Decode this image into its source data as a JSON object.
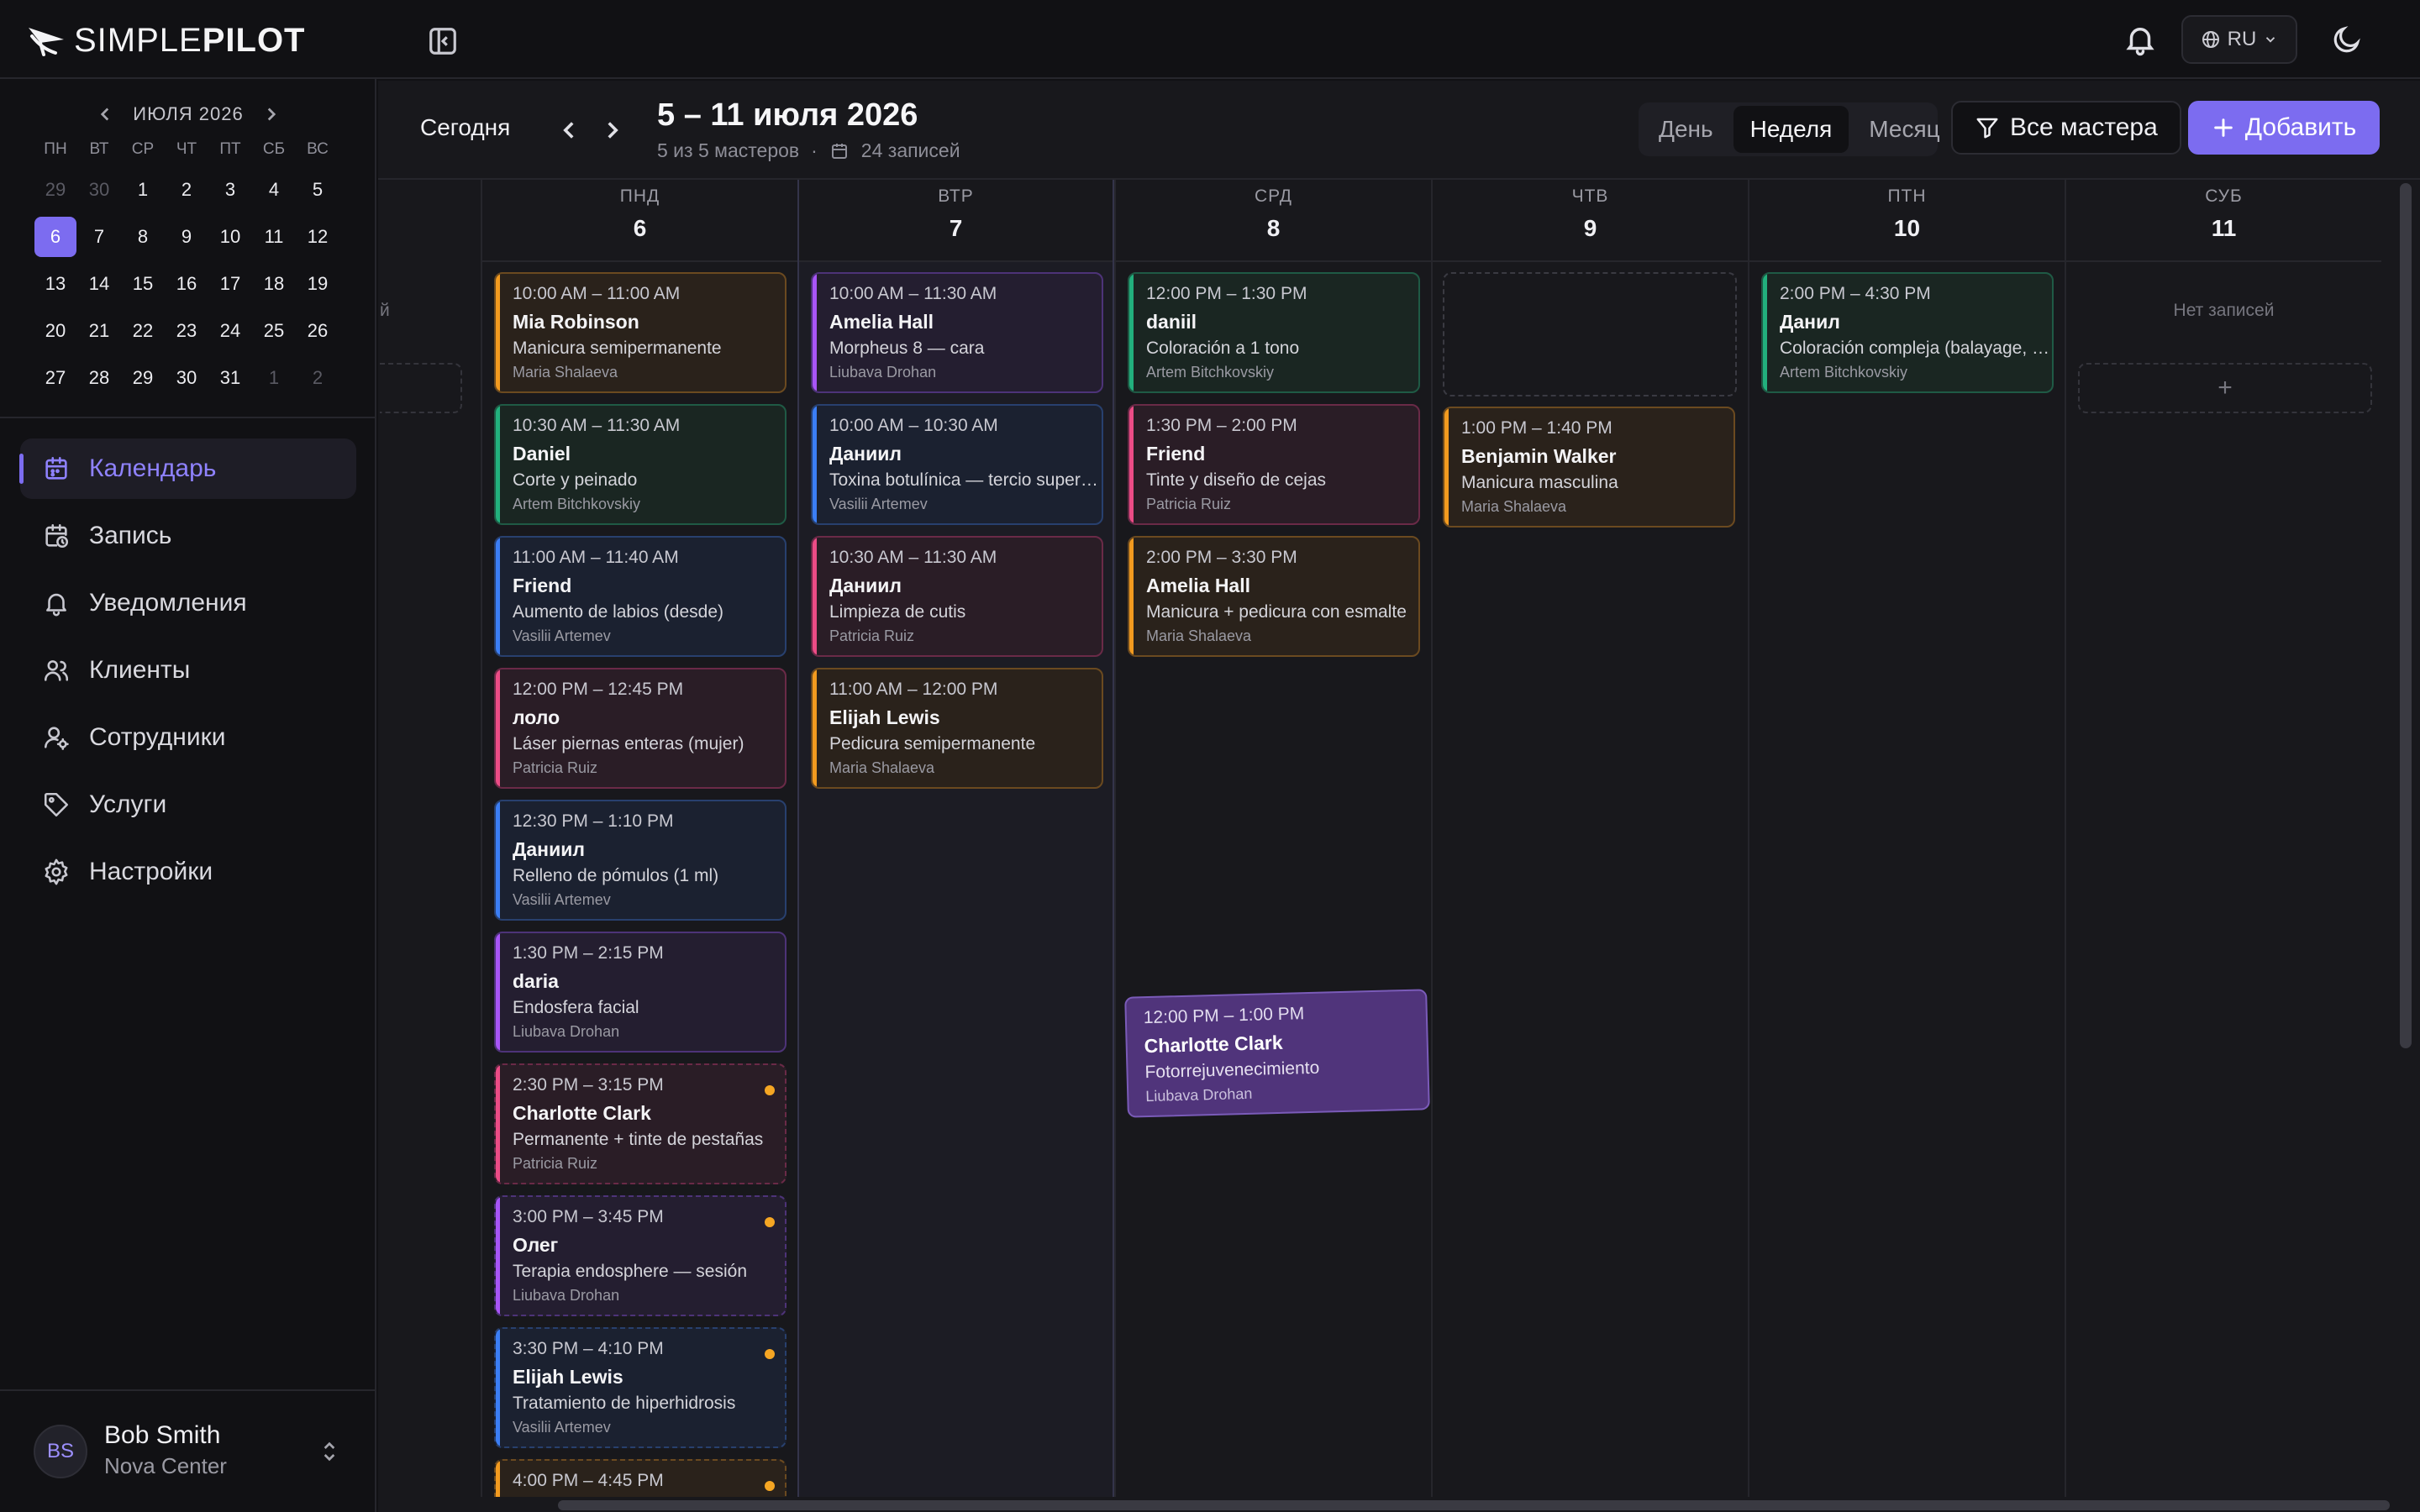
{
  "brand": {
    "logo_a": "SIMPLE",
    "logo_b": "PILOT"
  },
  "topbar": {
    "language": "RU"
  },
  "mini_calendar": {
    "month_label": "ИЮЛЯ 2026",
    "weekdays": [
      "ПН",
      "ВТ",
      "СР",
      "ЧТ",
      "ПТ",
      "СБ",
      "ВС"
    ],
    "days": [
      {
        "d": "29",
        "muted": true
      },
      {
        "d": "30",
        "muted": true
      },
      {
        "d": "1"
      },
      {
        "d": "2"
      },
      {
        "d": "3"
      },
      {
        "d": "4"
      },
      {
        "d": "5"
      },
      {
        "d": "6",
        "today": true
      },
      {
        "d": "7"
      },
      {
        "d": "8"
      },
      {
        "d": "9"
      },
      {
        "d": "10"
      },
      {
        "d": "11"
      },
      {
        "d": "12"
      },
      {
        "d": "13"
      },
      {
        "d": "14"
      },
      {
        "d": "15"
      },
      {
        "d": "16"
      },
      {
        "d": "17"
      },
      {
        "d": "18"
      },
      {
        "d": "19"
      },
      {
        "d": "20"
      },
      {
        "d": "21"
      },
      {
        "d": "22"
      },
      {
        "d": "23"
      },
      {
        "d": "24"
      },
      {
        "d": "25"
      },
      {
        "d": "26"
      },
      {
        "d": "27"
      },
      {
        "d": "28"
      },
      {
        "d": "29"
      },
      {
        "d": "30"
      },
      {
        "d": "31"
      },
      {
        "d": "1",
        "muted": true
      },
      {
        "d": "2",
        "muted": true
      }
    ]
  },
  "nav": [
    {
      "label": "Календарь",
      "icon": "calendar-icon",
      "active": true
    },
    {
      "label": "Запись",
      "icon": "calendar-clock-icon"
    },
    {
      "label": "Уведомления",
      "icon": "bell-icon"
    },
    {
      "label": "Клиенты",
      "icon": "users-icon"
    },
    {
      "label": "Сотрудники",
      "icon": "staff-icon"
    },
    {
      "label": "Услуги",
      "icon": "tag-icon"
    },
    {
      "label": "Настройки",
      "icon": "gear-icon"
    }
  ],
  "user": {
    "initials": "BS",
    "name": "Bob Smith",
    "org": "Nova Center"
  },
  "header": {
    "today": "Сегодня",
    "range": "5 – 11 июля 2026",
    "masters_count": "5 из 5 мастеров",
    "separator": "·",
    "records_count": "24 записей",
    "views": [
      {
        "label": "День"
      },
      {
        "label": "Неделя",
        "active": true
      },
      {
        "label": "Месяц"
      }
    ],
    "filter": "Все мастера",
    "add": "Добавить"
  },
  "colors": {
    "accent": "#7c6cf0",
    "orange": "#f29a1f",
    "green": "#22b07d",
    "blue": "#3b7ef5",
    "pink": "#ec4c86",
    "purple": "#a855f7",
    "pending_dot": "#f5a623"
  },
  "partial_column_text": "й",
  "days": [
    {
      "name": "ПНД",
      "num": "6",
      "appointments": [
        {
          "time": "10:00 AM – 11:00 AM",
          "client": "Mia Robinson",
          "service": "Manicura semipermanente",
          "staff": "Maria Shalaeva",
          "color": "orange"
        },
        {
          "time": "10:30 AM – 11:30 AM",
          "client": "Daniel",
          "service": "Corte y peinado",
          "staff": "Artem Bitchkovskiy",
          "color": "green"
        },
        {
          "time": "11:00 AM – 11:40 AM",
          "client": "Friend",
          "service": "Aumento de labios (desde)",
          "staff": "Vasilii Artemev",
          "color": "blue"
        },
        {
          "time": "12:00 PM – 12:45 PM",
          "client": "лоло",
          "service": "Láser piernas enteras (mujer)",
          "staff": "Patricia Ruiz",
          "color": "pink"
        },
        {
          "time": "12:30 PM – 1:10 PM",
          "client": "Даниил",
          "service": "Relleno de pómulos (1 ml)",
          "staff": "Vasilii Artemev",
          "color": "blue"
        },
        {
          "time": "1:30 PM – 2:15 PM",
          "client": "daria",
          "service": "Endosfera facial",
          "staff": "Liubava Drohan",
          "color": "purple"
        },
        {
          "time": "2:30 PM – 3:15 PM",
          "client": "Charlotte Clark",
          "service": "Permanente + tinte de pestañas",
          "staff": "Patricia Ruiz",
          "color": "pink",
          "pending": true
        },
        {
          "time": "3:00 PM – 3:45 PM",
          "client": "Олег",
          "service": "Terapia endosphere — sesión",
          "staff": "Liubava Drohan",
          "color": "purple",
          "pending": true
        },
        {
          "time": "3:30 PM – 4:10 PM",
          "client": "Elijah Lewis",
          "service": "Tratamiento de hiperhidrosis",
          "staff": "Vasilii Artemev",
          "color": "blue",
          "pending": true
        },
        {
          "time": "4:00 PM – 4:45 PM",
          "client": "",
          "service": "",
          "staff": "",
          "color": "orange",
          "pending": true
        }
      ]
    },
    {
      "name": "ВТР",
      "num": "7",
      "appointments": [
        {
          "time": "10:00 AM – 11:30 AM",
          "client": "Amelia Hall",
          "service": "Morpheus 8 — cara",
          "staff": "Liubava Drohan",
          "color": "purple"
        },
        {
          "time": "10:00 AM – 10:30 AM",
          "client": "Даниил",
          "service": "Toxina botulínica — tercio superior",
          "staff": "Vasilii Artemev",
          "color": "blue"
        },
        {
          "time": "10:30 AM – 11:30 AM",
          "client": "Даниил",
          "service": "Limpieza de cutis",
          "staff": "Patricia Ruiz",
          "color": "pink"
        },
        {
          "time": "11:00 AM – 12:00 PM",
          "client": "Elijah Lewis",
          "service": "Pedicura semipermanente",
          "staff": "Maria Shalaeva",
          "color": "orange"
        }
      ]
    },
    {
      "name": "СРД",
      "num": "8",
      "appointments": [
        {
          "time": "12:00 PM – 1:30 PM",
          "client": "daniil",
          "service": "Coloración a 1 tono",
          "staff": "Artem Bitchkovskiy",
          "color": "green"
        },
        {
          "time": "1:30 PM – 2:00 PM",
          "client": "Friend",
          "service": "Tinte y diseño de cejas",
          "staff": "Patricia Ruiz",
          "color": "pink"
        },
        {
          "time": "2:00 PM – 3:30 PM",
          "client": "Amelia Hall",
          "service": "Manicura + pedicura con esmalte",
          "staff": "Maria Shalaeva",
          "color": "orange"
        }
      ]
    },
    {
      "name": "ЧТВ",
      "num": "9",
      "appointments": [
        {
          "time": "1:00 PM – 1:40 PM",
          "client": "Benjamin Walker",
          "service": "Manicura masculina",
          "staff": "Maria Shalaeva",
          "color": "orange"
        }
      ]
    },
    {
      "name": "ПТН",
      "num": "10",
      "appointments": [
        {
          "time": "2:00 PM – 4:30 PM",
          "client": "Данил",
          "service": "Coloración compleja (balayage, ombré)",
          "staff": "Artem Bitchkovskiy",
          "color": "green"
        }
      ]
    },
    {
      "name": "СУБ",
      "num": "11",
      "appointments": [],
      "empty_text": "Нет записей",
      "add_symbol": "+"
    }
  ],
  "dragging": {
    "time": "12:00 PM – 1:00 PM",
    "client": "Charlotte Clark",
    "service": "Fotorrejuvenecimiento",
    "staff": "Liubava Drohan"
  }
}
